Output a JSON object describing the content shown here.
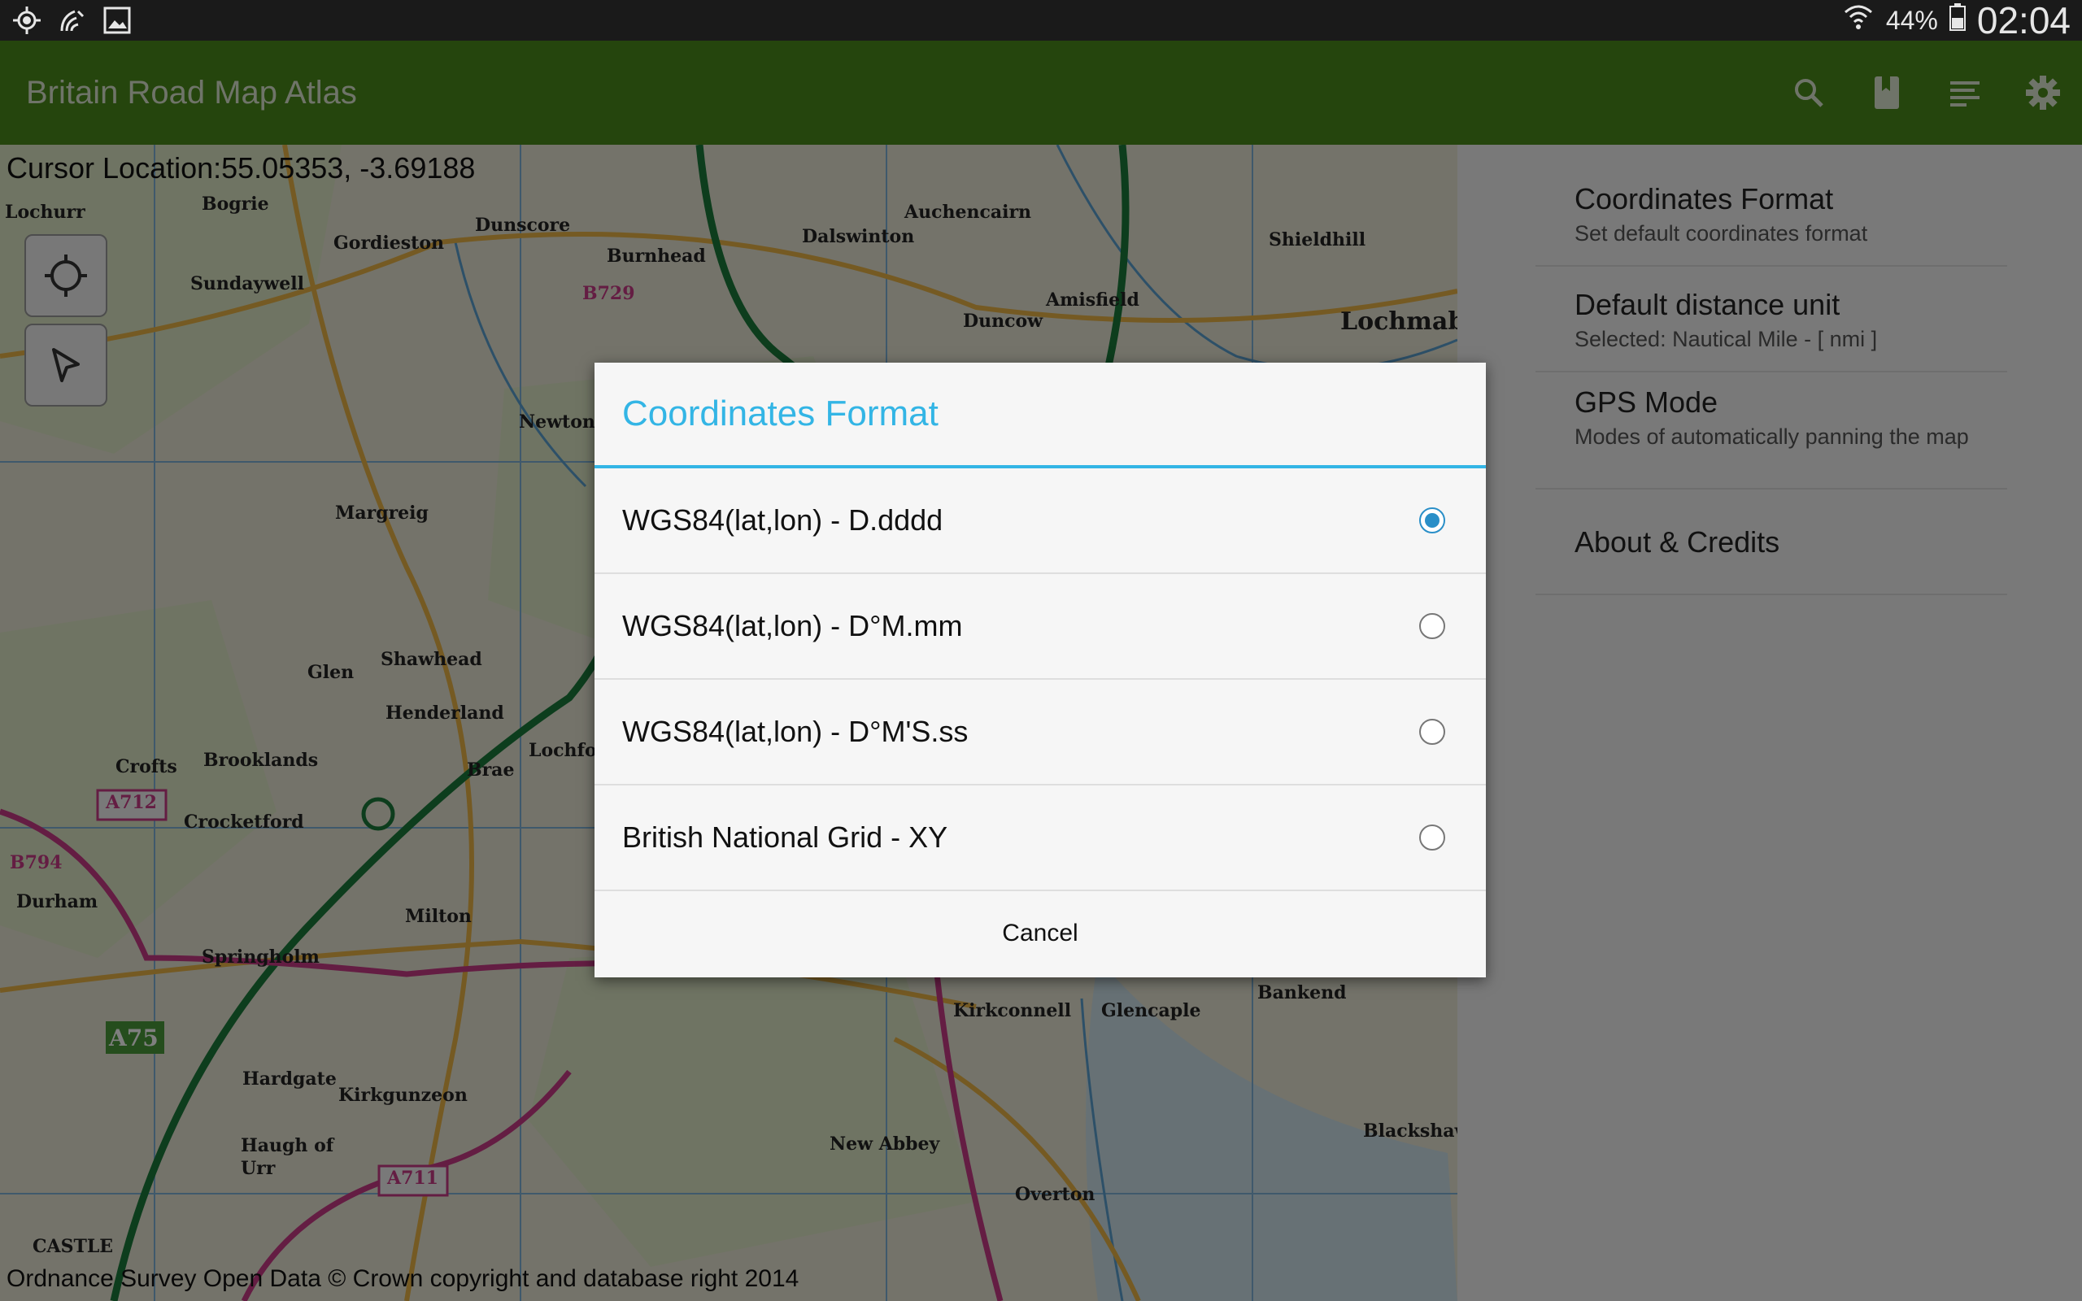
{
  "status_bar": {
    "icons_left": [
      "gps-icon",
      "nfc-icon",
      "gallery-icon"
    ],
    "battery": "44%",
    "time": "02:04"
  },
  "action_bar": {
    "title": "Britain Road Map Atlas",
    "actions": [
      "search-icon",
      "bookmark-icon",
      "list-icon",
      "settings-icon"
    ]
  },
  "map": {
    "cursor_location": "Cursor Location:55.05353, -3.69188",
    "attribution": "Ordnance Survey Open Data © Crown copyright and database right 2014",
    "place_labels": [
      {
        "text": "Lochurr"
      },
      {
        "text": "Bogrie"
      },
      {
        "text": "Dunscore"
      },
      {
        "text": "Gordieston"
      },
      {
        "text": "Sundaywell"
      },
      {
        "text": "Burnhead"
      },
      {
        "text": "Dalswinton"
      },
      {
        "text": "Auchencairn"
      },
      {
        "text": "Duncow"
      },
      {
        "text": "Amisfield"
      },
      {
        "text": "Shieldhill"
      },
      {
        "text": "Lochmabe"
      },
      {
        "text": "Margreig"
      },
      {
        "text": "Shawhead"
      },
      {
        "text": "Glen"
      },
      {
        "text": "Henderland"
      },
      {
        "text": "Brooklands"
      },
      {
        "text": "Crofts"
      },
      {
        "text": "Crocketford"
      },
      {
        "text": "Milton"
      },
      {
        "text": "Springholm"
      },
      {
        "text": "Hardgate"
      },
      {
        "text": "Kirkgunzeon"
      },
      {
        "text": "Kirkconnell"
      },
      {
        "text": "Glencaple"
      },
      {
        "text": "Bankend"
      },
      {
        "text": "New Abbey"
      },
      {
        "text": "Overton"
      },
      {
        "text": "Blackshaw"
      },
      {
        "text": "Newtonai"
      },
      {
        "text": "Brae"
      },
      {
        "text": "Lochfoo"
      },
      {
        "text": "Durham"
      },
      {
        "text": "Haugh of"
      },
      {
        "text": "Urr"
      },
      {
        "text": "CASTLE"
      }
    ],
    "road_labels": [
      "A712",
      "A75",
      "A711",
      "B794",
      "B729"
    ]
  },
  "settings": {
    "items": [
      {
        "title": "Coordinates Format",
        "summary": "Set default coordinates format"
      },
      {
        "title": "Default distance unit",
        "summary": "Selected: Nautical Mile - [ nmi ]"
      },
      {
        "title": "GPS Mode",
        "summary": "Modes of automatically panning the map"
      },
      {
        "title": "About & Credits",
        "summary": ""
      }
    ]
  },
  "dialog": {
    "title": "Coordinates Format",
    "options": [
      {
        "label": "WGS84(lat,lon) - D.dddd",
        "checked": true
      },
      {
        "label": "WGS84(lat,lon) - D°M.mm",
        "checked": false
      },
      {
        "label": "WGS84(lat,lon) - D°M'S.ss",
        "checked": false
      },
      {
        "label": "British National Grid - XY",
        "checked": false
      }
    ],
    "cancel": "Cancel"
  },
  "colors": {
    "action_bar": "#4a8a1a",
    "accent": "#33b5e5",
    "radio_checked": "#2a8fc8"
  }
}
